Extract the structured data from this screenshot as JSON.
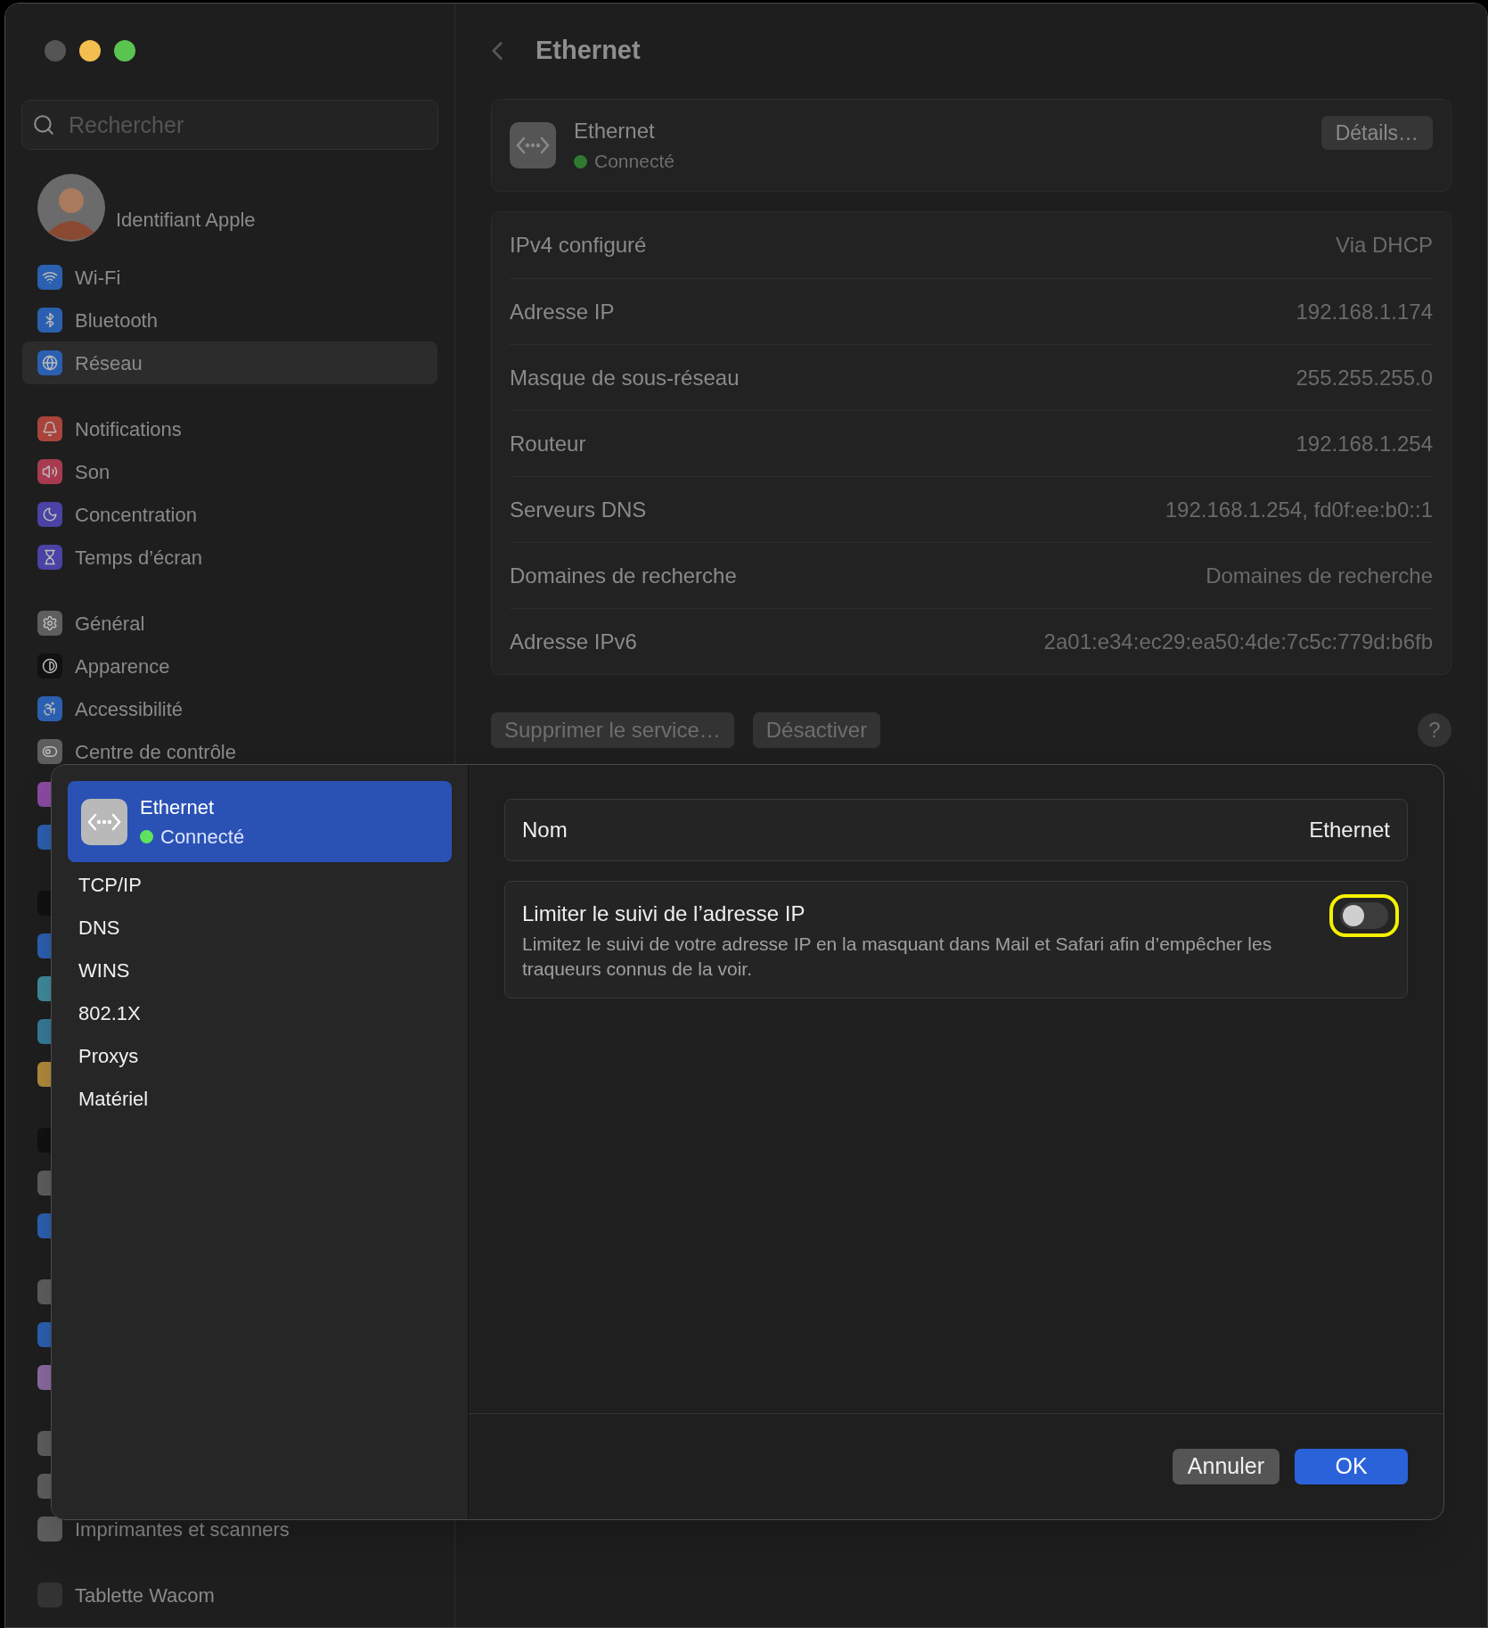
{
  "search": {
    "placeholder": "Rechercher"
  },
  "profile": {
    "subtitle": "Identifiant Apple"
  },
  "sidebar": {
    "groups": [
      {
        "items": [
          {
            "label": "Wi-Fi",
            "selected": false,
            "color": "#2b5fb0"
          },
          {
            "label": "Bluetooth",
            "selected": false,
            "color": "#2b5fb0"
          },
          {
            "label": "Réseau",
            "selected": true,
            "color": "#2b5fb0"
          }
        ]
      },
      {
        "items": [
          {
            "label": "Notifications",
            "selected": false,
            "color": "#a8443c"
          },
          {
            "label": "Son",
            "selected": false,
            "color": "#a83a50"
          },
          {
            "label": "Concentration",
            "selected": false,
            "color": "#4a42a4"
          },
          {
            "label": "Temps d’écran",
            "selected": false,
            "color": "#4a42a4"
          }
        ]
      },
      {
        "items": [
          {
            "label": "Général",
            "selected": false,
            "color": "#5e5e5e"
          },
          {
            "label": "Apparence",
            "selected": false,
            "color": "#111111"
          },
          {
            "label": "Accessibilité",
            "selected": false,
            "color": "#2b5fb0"
          },
          {
            "label": "Centre de contrôle",
            "selected": false,
            "color": "#5e5e5e"
          },
          {
            "selected": false,
            "color": "#8a4aa0"
          },
          {
            "selected": false,
            "color": "#2b5fb0"
          }
        ]
      },
      {
        "items": [
          {
            "selected": false,
            "color": "#111111"
          },
          {
            "selected": false,
            "color": "#2b5fb0"
          },
          {
            "selected": false,
            "color": "#3f8a9a"
          },
          {
            "selected": false,
            "color": "#357a9a"
          },
          {
            "selected": false,
            "color": "#b08a3a"
          }
        ]
      },
      {
        "items": [
          {
            "selected": false,
            "color": "#111111"
          },
          {
            "selected": false,
            "color": "#5e5e5e"
          },
          {
            "selected": false,
            "color": "#2b5fb0"
          }
        ]
      },
      {
        "items": [
          {
            "selected": false,
            "color": "#5e5e5e"
          },
          {
            "selected": false,
            "color": "#2b5fb0"
          },
          {
            "selected": false,
            "color": "#8a6aa0"
          }
        ]
      },
      {
        "items": [
          {
            "selected": false,
            "color": "#5e5e5e"
          },
          {
            "selected": false,
            "color": "#5e5e5e"
          },
          {
            "label": "Imprimantes et scanners",
            "selected": false,
            "color": "#5e5e5e"
          }
        ]
      },
      {
        "items": [
          {
            "label": "Tablette Wacom",
            "selected": false,
            "color": "#333333"
          }
        ]
      }
    ]
  },
  "main": {
    "title": "Ethernet",
    "service": {
      "name": "Ethernet",
      "status": "Connecté",
      "details_button": "Détails…"
    },
    "info_rows": [
      {
        "label": "IPv4 configuré",
        "value": "Via DHCP"
      },
      {
        "label": "Adresse IP",
        "value": "192.168.1.174"
      },
      {
        "label": "Masque de sous-réseau",
        "value": "255.255.255.0"
      },
      {
        "label": "Routeur",
        "value": "192.168.1.254"
      },
      {
        "label": "Serveurs DNS",
        "value": "192.168.1.254, fd0f:ee:b0::1"
      },
      {
        "label": "Domaines de recherche",
        "value": "Domaines de recherche"
      },
      {
        "label": "Adresse IPv6",
        "value": "2a01:e34:ec29:ea50:4de:7c5c:779d:b6fb"
      }
    ],
    "buttons": [
      "Supprimer le service…",
      "Désactiver"
    ],
    "help": "?"
  },
  "sheet": {
    "service": {
      "name": "Ethernet",
      "status": "Connecté",
      "selected": true
    },
    "tabs": [
      {
        "label": "TCP/IP",
        "selected": false
      },
      {
        "label": "DNS",
        "selected": false
      },
      {
        "label": "WINS",
        "selected": false
      },
      {
        "label": "802.1X",
        "selected": false
      },
      {
        "label": "Proxys",
        "selected": false
      },
      {
        "label": "Matériel",
        "selected": false
      }
    ],
    "name_row": {
      "label": "Nom",
      "value": "Ethernet"
    },
    "limit_tracking": {
      "title": "Limiter le suivi de l’adresse IP",
      "description": "Limitez le suivi de votre adresse IP en la masquant dans Mail et Safari afin d’empêcher les traqueurs connus de la voir.",
      "on": false,
      "highlighted": true
    },
    "buttons": [
      {
        "label": "Annuler",
        "kind": "secondary"
      },
      {
        "label": "OK",
        "kind": "primary"
      }
    ]
  }
}
